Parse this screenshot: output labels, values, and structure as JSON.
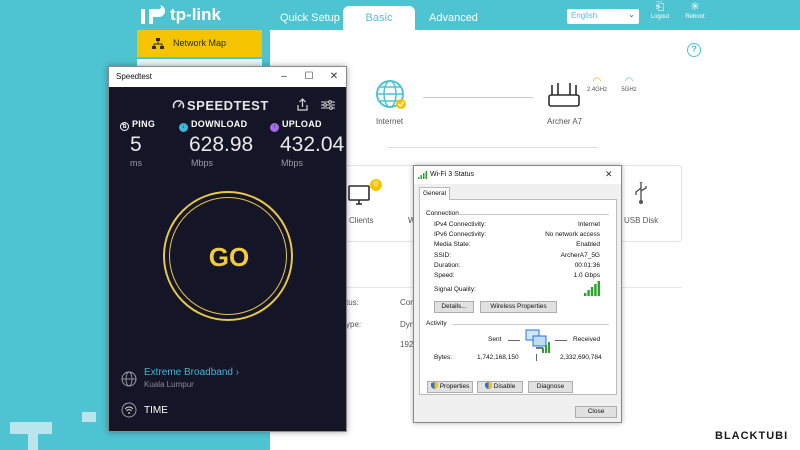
{
  "router": {
    "brand": "tp-link",
    "nav": {
      "quick_setup": "Quick Setup",
      "basic": "Basic",
      "advanced": "Advanced"
    },
    "language": "English",
    "logout_label": "Logout",
    "reboot_label": "Reboot",
    "sidebar": {
      "network_map": "Network Map"
    },
    "help": "?",
    "internet_label": "Internet",
    "router_label": "Archer A7",
    "band_24": "2.4GHz",
    "band_5": "5GHz",
    "clients_badge": "0",
    "clients_label": "Clients",
    "wireless_fragment": "W",
    "usb_label": "USB Disk",
    "fragments": [
      "tus:",
      "Con",
      "ype:",
      "Dyn",
      "192"
    ]
  },
  "speedtest": {
    "window_title": "Speedtest",
    "brand": "SPEEDTEST",
    "ping": {
      "label": "PING",
      "value": "5",
      "unit": "ms"
    },
    "download": {
      "label": "DOWNLOAD",
      "value": "628.98",
      "unit": "Mbps"
    },
    "upload": {
      "label": "UPLOAD",
      "value": "432.04",
      "unit": "Mbps"
    },
    "go_label": "GO",
    "isp": "Extreme Broadband",
    "isp_arrow": "›",
    "location": "Kuala Lumpur",
    "server_label": "TIME"
  },
  "wifi_status": {
    "title": "Wi-Fi 3 Status",
    "tab": "General",
    "connection_heading": "Connection",
    "rows": [
      {
        "label": "IPv4 Connectivity:",
        "value": "Internet"
      },
      {
        "label": "IPv6 Connectivity:",
        "value": "No network access"
      },
      {
        "label": "Media State:",
        "value": "Enabled"
      },
      {
        "label": "SSID:",
        "value": "ArcherA7_5G"
      },
      {
        "label": "Duration:",
        "value": "00:01:36"
      },
      {
        "label": "Speed:",
        "value": "1.0 Gbps"
      }
    ],
    "signal_label": "Signal Quality:",
    "signal_level": 5,
    "details_button": "Details...",
    "wireless_props_button": "Wireless Properties",
    "activity_heading": "Activity",
    "sent_label": "Sent",
    "received_label": "Received",
    "bytes_label": "Bytes:",
    "bytes_sent": "1,742,168,150",
    "bytes_received": "2,332,690,784",
    "properties_button": "Properties",
    "disable_button": "Disable",
    "diagnose_button": "Diagnose",
    "close_button": "Close"
  },
  "watermark": "BLACKTUBI",
  "colors": {
    "tp_teal": "#4ec3d1",
    "tp_yellow": "#f5c400",
    "speedtest_bg": "#141526",
    "speedtest_gold": "#e8c74a",
    "download_cyan": "#3db7d9",
    "upload_purple": "#a56be8",
    "signal_green": "#2aa52a"
  }
}
